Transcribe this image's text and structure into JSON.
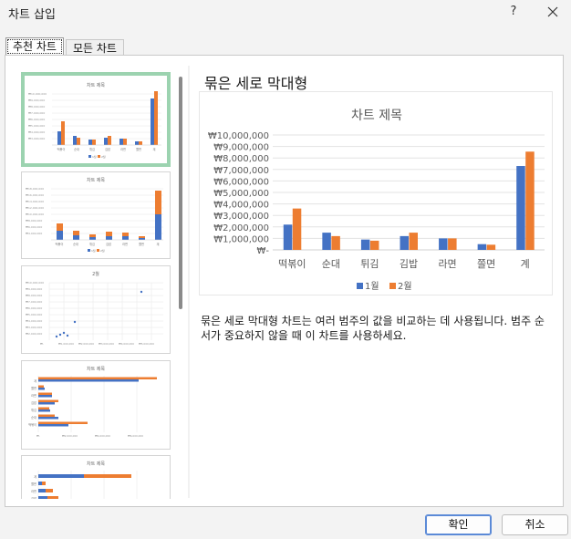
{
  "dialog": {
    "title": "차트 삽입",
    "help_label": "?",
    "ok_label": "확인",
    "cancel_label": "취소"
  },
  "tabs": [
    {
      "label": "추천 차트",
      "active": true
    },
    {
      "label": "모든 차트",
      "active": false
    }
  ],
  "thumbnails": [
    {
      "title": "차트 제목",
      "type": "clustered-column",
      "selected": true
    },
    {
      "title": "차트 제목",
      "type": "stacked-column",
      "selected": false
    },
    {
      "title": "2월",
      "type": "scatter",
      "selected": false
    },
    {
      "title": "차트 제목",
      "type": "clustered-bar",
      "selected": false
    },
    {
      "title": "차트 제목",
      "type": "stacked-bar",
      "selected": false
    }
  ],
  "preview": {
    "title": "묶은 세로 막대형",
    "description": "묶은 세로 막대형 차트는 여러 범주의 값을 비교하는 데 사용됩니다. 범주 순서가 중요하지 않을 때 이 차트를 사용하세요."
  },
  "colors": {
    "series1": "#4472c4",
    "series2": "#ed7d31",
    "selected_border": "#9cd3b0"
  },
  "chart_data": {
    "type": "bar",
    "title": "차트 제목",
    "categories": [
      "떡볶이",
      "순대",
      "튀김",
      "김밥",
      "라면",
      "쫄면",
      "계"
    ],
    "series": [
      {
        "name": "1월",
        "values": [
          2200000,
          1500000,
          900000,
          1200000,
          1000000,
          500000,
          7300000
        ]
      },
      {
        "name": "2월",
        "values": [
          3600000,
          1200000,
          800000,
          1500000,
          1000000,
          450000,
          8550000
        ]
      }
    ],
    "yticks": [
      "₩10,000,000",
      "₩9,000,000",
      "₩8,000,000",
      "₩7,000,000",
      "₩6,000,000",
      "₩5,000,000",
      "₩4,000,000",
      "₩3,000,000",
      "₩2,000,000",
      "₩1,000,000",
      "₩-"
    ],
    "ylim": [
      0,
      10000000
    ],
    "grid": true,
    "legend": "bottom"
  }
}
